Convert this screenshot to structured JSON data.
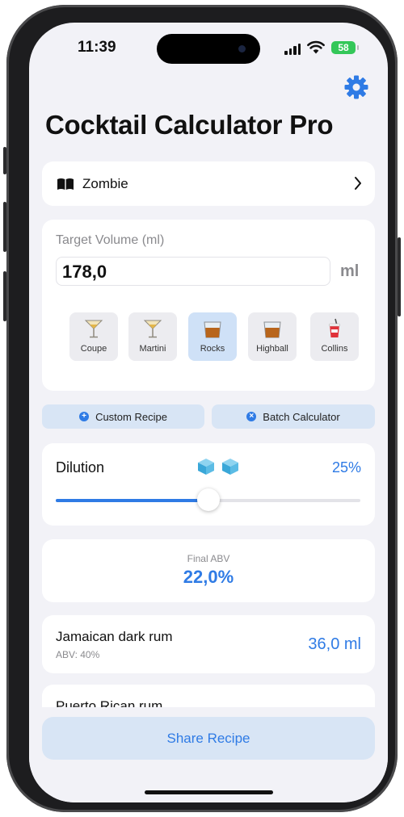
{
  "status": {
    "time": "11:39",
    "battery": "58"
  },
  "header": {
    "title": "Cocktail Calculator Pro",
    "settings_icon": "gear-icon"
  },
  "recipe": {
    "name": "Zombie"
  },
  "volume": {
    "label": "Target Volume (ml)",
    "value": "178,0",
    "unit": "ml",
    "glasses": [
      {
        "label": "Coupe",
        "icon": "cocktail-glass-icon",
        "selected": false
      },
      {
        "label": "Martini",
        "icon": "cocktail-glass-icon",
        "selected": false
      },
      {
        "label": "Rocks",
        "icon": "tumbler-glass-icon",
        "selected": true
      },
      {
        "label": "Highball",
        "icon": "tumbler-glass-icon",
        "selected": false
      },
      {
        "label": "Collins",
        "icon": "cup-with-straw-icon",
        "selected": false
      }
    ]
  },
  "actions": {
    "custom_recipe": "Custom Recipe",
    "batch_calculator": "Batch Calculator"
  },
  "dilution": {
    "label": "Dilution",
    "value": "25%",
    "fraction": 0.25
  },
  "final_abv": {
    "label": "Final ABV",
    "value": "22,0%"
  },
  "ingredients": [
    {
      "name": "Jamaican dark rum",
      "abv": "ABV: 40%",
      "amount": "36,0 ml"
    },
    {
      "name": "Puerto Rican rum",
      "abv": "",
      "amount": ""
    }
  ],
  "share_button": "Share Recipe",
  "colors": {
    "accent": "#2f7be5",
    "background": "#f2f2f7",
    "selected_glass": "#cfe1f7"
  }
}
